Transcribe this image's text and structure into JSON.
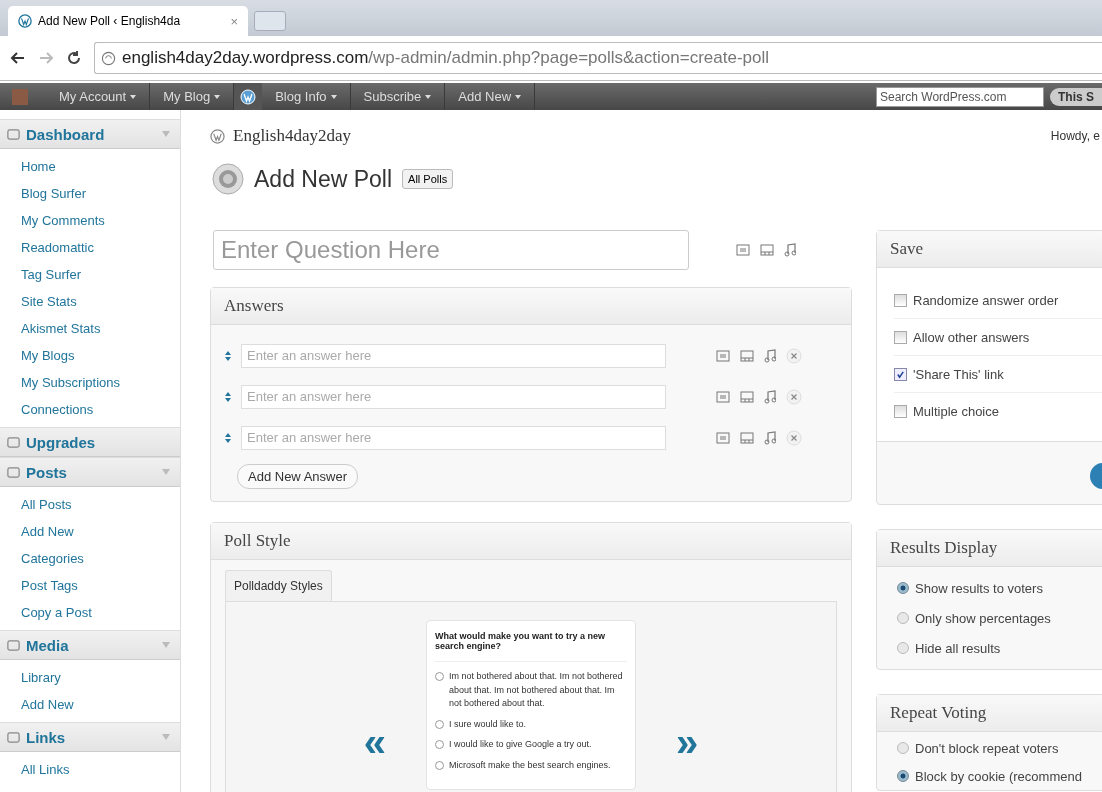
{
  "browser": {
    "tab": {
      "title": "Add New Poll ‹ English4da",
      "close": "×"
    },
    "url": {
      "domain": "english4day2day.wordpress.com",
      "path": "/wp-admin/admin.php?page=polls&action=create-poll"
    }
  },
  "admin_bar": {
    "menus": [
      "My Account",
      "My Blog",
      "Blog Info",
      "Subscribe",
      "Add New"
    ],
    "search": {
      "placeholder": "Search WordPress.com"
    },
    "search_button": "This S"
  },
  "sidebar": [
    {
      "title": "Dashboard",
      "toggle": true,
      "items": [
        "Home",
        "Blog Surfer",
        "My Comments",
        "Readomattic",
        "Tag Surfer",
        "Site Stats",
        "Akismet Stats",
        "My Blogs",
        "My Subscriptions",
        "Connections"
      ]
    },
    {
      "title": "Upgrades",
      "toggle": false
    },
    {
      "title": "Posts",
      "toggle": true,
      "items": [
        "All Posts",
        "Add New",
        "Categories",
        "Post Tags",
        "Copy a Post"
      ]
    },
    {
      "title": "Media",
      "toggle": true,
      "items": [
        "Library",
        "Add New"
      ]
    },
    {
      "title": "Links",
      "toggle": true,
      "items": [
        "All Links"
      ]
    }
  ],
  "site": {
    "name": "English4day2day",
    "greeting": "Howdy, e"
  },
  "page": {
    "title": "Add New Poll",
    "all_button": "All Polls"
  },
  "question": {
    "placeholder": "Enter Question Here"
  },
  "answers": {
    "title": "Answers",
    "rows": [
      {
        "placeholder": "Enter an answer here"
      },
      {
        "placeholder": "Enter an answer here"
      },
      {
        "placeholder": "Enter an answer here"
      }
    ],
    "add_button": "Add New Answer"
  },
  "poll_style": {
    "title": "Poll Style",
    "tab": "Polldaddy Styles",
    "prev": "«",
    "next": "»",
    "preview": {
      "question": "What would make you want to try a new search engine?",
      "options": [
        {
          "text": "Im not bothered about that. Im not bothered about that. Im not bothered about that. Im not bothered about that.",
          "selected": false
        },
        {
          "text": "I sure would like to.",
          "selected": false
        },
        {
          "text": "I would like to give Google a try out.",
          "selected": false
        },
        {
          "text": "Microsoft make the best search engines.",
          "selected": false
        }
      ]
    }
  },
  "save": {
    "title": "Save",
    "options": [
      {
        "label": "Randomize answer order",
        "checked": false
      },
      {
        "label": "Allow other answers",
        "checked": false
      },
      {
        "label": "'Share This' link",
        "checked": true
      },
      {
        "label": "Multiple choice",
        "checked": false
      }
    ]
  },
  "results_display": {
    "title": "Results Display",
    "options": [
      {
        "label": "Show results to voters",
        "selected": true
      },
      {
        "label": "Only show percentages",
        "selected": false
      },
      {
        "label": "Hide all results",
        "selected": false
      }
    ]
  },
  "repeat_voting": {
    "title": "Repeat Voting",
    "options": [
      {
        "label": "Don't block repeat voters",
        "selected": false
      },
      {
        "label": "Block by cookie (recommend",
        "selected": true
      }
    ]
  }
}
